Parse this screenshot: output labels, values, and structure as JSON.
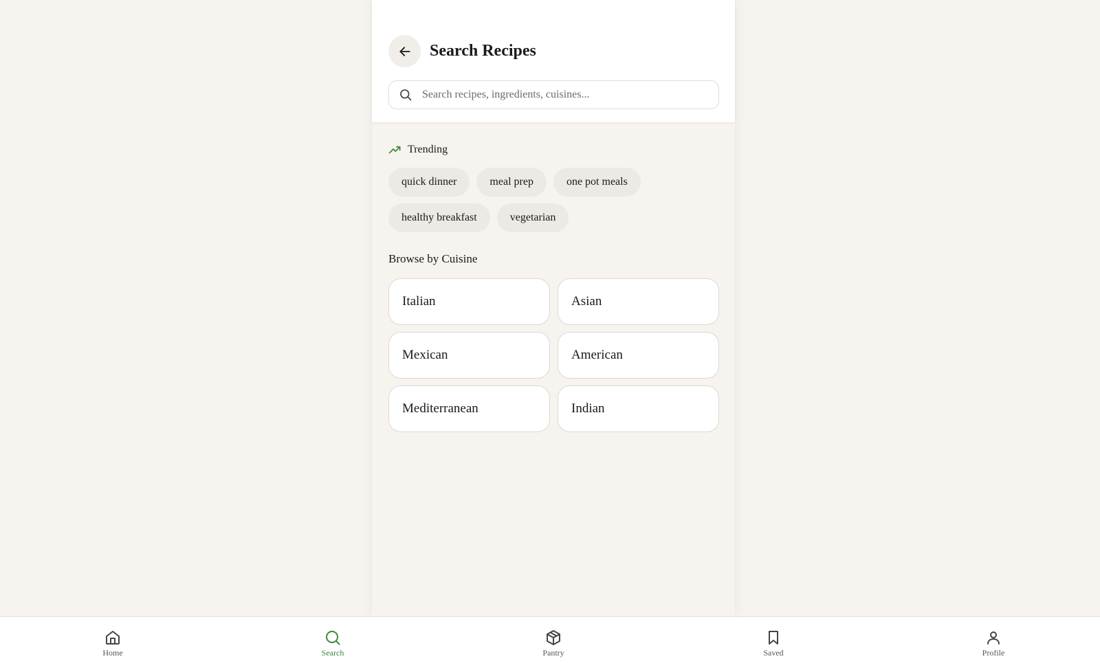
{
  "header": {
    "title": "Search Recipes",
    "back_icon": "arrow-left-icon"
  },
  "search": {
    "placeholder": "Search recipes, ingredients, cuisines...",
    "value": ""
  },
  "trending": {
    "label": "Trending",
    "icon": "trending-up-icon",
    "chips": [
      "quick dinner",
      "meal prep",
      "one pot meals",
      "healthy breakfast",
      "vegetarian"
    ]
  },
  "browse": {
    "title": "Browse by Cuisine",
    "cuisines": [
      "Italian",
      "Asian",
      "Mexican",
      "American",
      "Mediterranean",
      "Indian"
    ]
  },
  "tabbar": {
    "active": "Search",
    "tabs": [
      {
        "label": "Home",
        "icon": "home-icon"
      },
      {
        "label": "Search",
        "icon": "search-icon"
      },
      {
        "label": "Pantry",
        "icon": "box-icon"
      },
      {
        "label": "Saved",
        "icon": "bookmark-icon"
      },
      {
        "label": "Profile",
        "icon": "user-icon"
      }
    ]
  },
  "colors": {
    "accent": "#3a8a3f",
    "background": "#f7f3ee",
    "chip": "#ede9e4"
  }
}
